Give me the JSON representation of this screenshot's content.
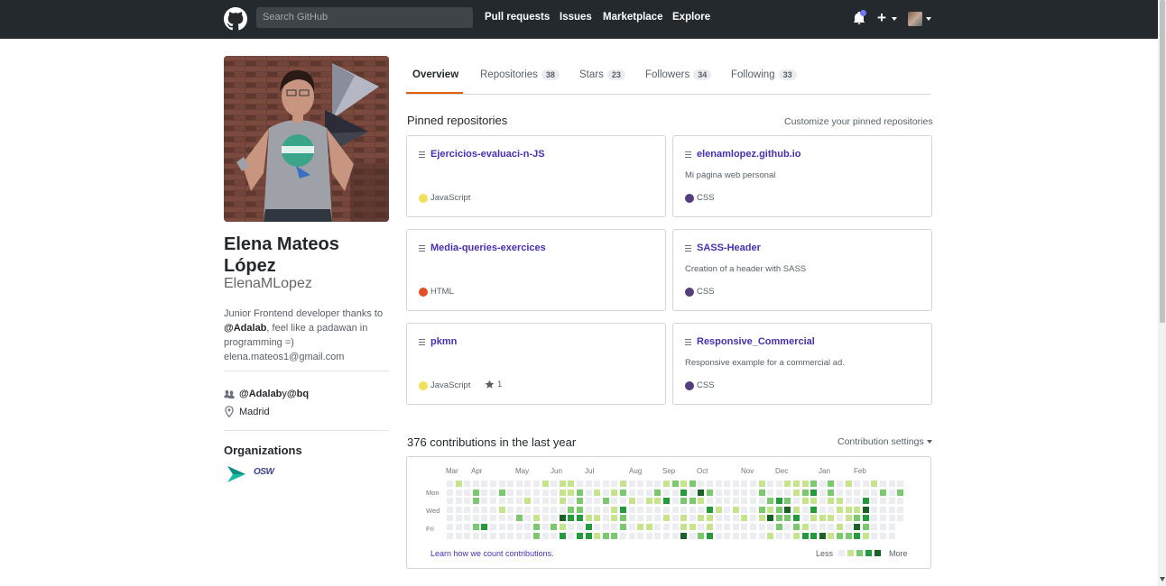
{
  "header": {
    "search_placeholder": "Search GitHub",
    "nav": [
      "Pull requests",
      "Issues",
      "Marketplace",
      "Explore"
    ],
    "plus_label": "+"
  },
  "profile": {
    "name": "Elena Mateos López",
    "login": "ElenaMLopez",
    "bio_prefix": "Junior Frontend developer thanks to ",
    "bio_mention": "@Adalab",
    "bio_suffix": ", feel like a padawan in programming =)",
    "email": "elena.mateos1@gmail.com",
    "company_a": "@Adalab",
    "company_join": " y ",
    "company_b": "@bq",
    "location": "Madrid",
    "orgs_title": "Organizations",
    "org2_label": "OSW"
  },
  "tabs": [
    {
      "label": "Overview",
      "count": null
    },
    {
      "label": "Repositories",
      "count": "38"
    },
    {
      "label": "Stars",
      "count": "23"
    },
    {
      "label": "Followers",
      "count": "34"
    },
    {
      "label": "Following",
      "count": "33"
    }
  ],
  "pinned": {
    "title": "Pinned repositories",
    "customize": "Customize your pinned repositories",
    "repos": [
      {
        "name": "Ejercicios-evaluaci-n-JS",
        "desc": "",
        "lang": "JavaScript",
        "color": "#f1e05a",
        "stars": ""
      },
      {
        "name": "elenamlopez.github.io",
        "desc": "Mi página web personal",
        "lang": "CSS",
        "color": "#563d7c",
        "stars": ""
      },
      {
        "name": "Media-queries-exercices",
        "desc": "",
        "lang": "HTML",
        "color": "#e34c26",
        "stars": ""
      },
      {
        "name": "SASS-Header",
        "desc": "Creation of a header with SASS",
        "lang": "CSS",
        "color": "#563d7c",
        "stars": ""
      },
      {
        "name": "pkmn",
        "desc": "",
        "lang": "JavaScript",
        "color": "#f1e05a",
        "stars": "1"
      },
      {
        "name": "Responsive_Commercial",
        "desc": "Responsive example for a commercial ad.",
        "lang": "CSS",
        "color": "#563d7c",
        "stars": ""
      }
    ]
  },
  "contributions": {
    "title": "376 contributions in the last year",
    "settings": "Contribution settings",
    "months": [
      "Mar",
      "Apr",
      "May",
      "Jun",
      "Jul",
      "Aug",
      "Sep",
      "Oct",
      "Nov",
      "Dec",
      "Jan",
      "Feb"
    ],
    "days": [
      "Mon",
      "Wed",
      "Fri"
    ],
    "learn": "Learn how we count contributions.",
    "less": "Less",
    "more": "More",
    "palette": [
      "#ebedf0",
      "#c6e48b",
      "#7bc96f",
      "#239a3b",
      "#196127"
    ]
  }
}
